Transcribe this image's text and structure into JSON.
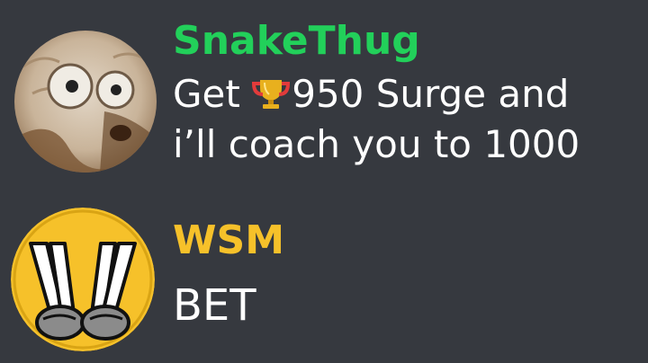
{
  "messages": [
    {
      "username": "SnakeThug",
      "username_color": "#22d05a",
      "avatar_icon": "monster-face-avatar",
      "text_part1": "Get ",
      "trophy_icon": "trophy-icon",
      "text_part2": "950 Surge and",
      "text_line2": "i’ll coach you to 1000"
    },
    {
      "username": "WSM",
      "username_color": "#f6c12a",
      "avatar_icon": "peace-hands-w-logo",
      "text": "BET"
    }
  ]
}
